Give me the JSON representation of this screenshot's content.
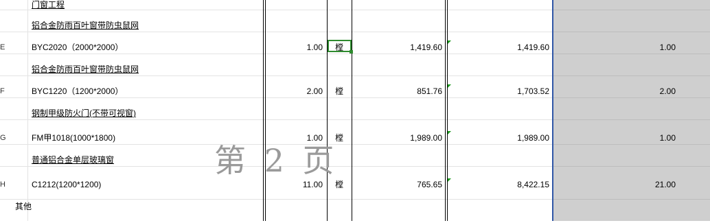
{
  "rows": [
    {
      "label": "",
      "name": "门窗工程",
      "qty": "",
      "unit": "",
      "price": "",
      "total": "",
      "gqty": ""
    },
    {
      "label": "",
      "name": "铝合金防雨百叶窗带防虫鼠网",
      "qty": "",
      "unit": "",
      "price": "",
      "total": "",
      "gqty": ""
    },
    {
      "label": "E",
      "name": "BYC2020（2000*2000）",
      "qty": "1.00",
      "unit": "樘",
      "price": "1,419.60",
      "total": "1,419.60",
      "gqty": "1.00"
    },
    {
      "label": "",
      "name": "铝合金防雨百叶窗带防虫鼠网",
      "qty": "",
      "unit": "",
      "price": "",
      "total": "",
      "gqty": ""
    },
    {
      "label": "F",
      "name": "BYC1220（1200*2000）",
      "qty": "2.00",
      "unit": "樘",
      "price": "851.76",
      "total": "1,703.52",
      "gqty": "2.00"
    },
    {
      "label": "",
      "name": "钢制甲级防火门(不带可视窗)",
      "qty": "",
      "unit": "",
      "price": "",
      "total": "",
      "gqty": ""
    },
    {
      "label": "G",
      "name": "FM甲1018(1000*1800)",
      "qty": "1.00",
      "unit": "樘",
      "price": "1,989.00",
      "total": "1,989.00",
      "gqty": "1.00"
    },
    {
      "label": "",
      "name": "普通铝合金单层玻璃窗",
      "qty": "",
      "unit": "",
      "price": "",
      "total": "",
      "gqty": ""
    },
    {
      "label": "H",
      "name": "C1212(1200*1200)",
      "qty": "11.00",
      "unit": "樘",
      "price": "765.65",
      "total": "8,422.15",
      "gqty": "21.00"
    },
    {
      "label": "",
      "name": "其他",
      "qty": "",
      "unit": "",
      "price": "",
      "total": "",
      "gqty": ""
    }
  ],
  "watermark": "第 2 页",
  "colors": {
    "grid": "#e3e3e3",
    "selection": "#2e8b2e",
    "comment_marker": "#1a9a1a",
    "gray_column": "#cfcfcf",
    "freeze_line": "#2f56a6"
  }
}
